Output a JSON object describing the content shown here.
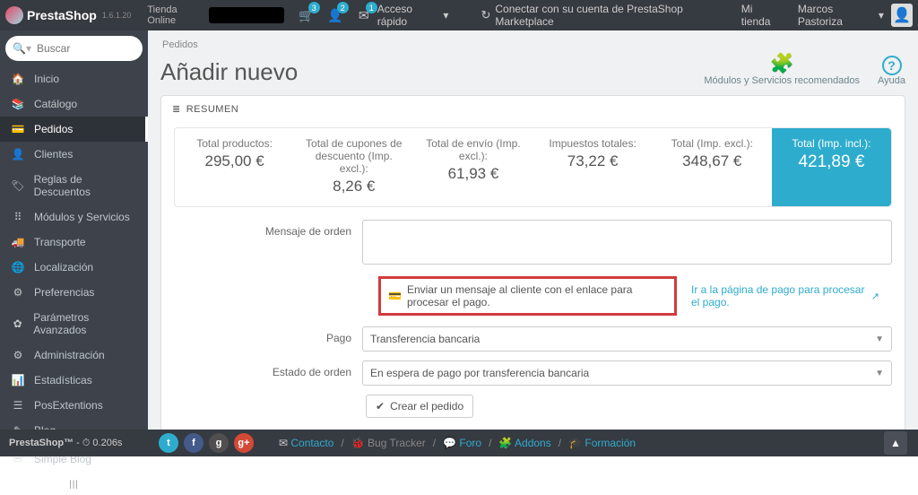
{
  "topbar": {
    "brand": "PrestaShop",
    "version": "1.6.1.20",
    "shop_name": "Tienda Online",
    "badges": {
      "cart": "3",
      "users": "2",
      "mail": "1"
    },
    "quick_access": "Acceso rápido",
    "marketplace": "Conectar con su cuenta de PrestaShop Marketplace",
    "my_shop": "Mi tienda",
    "user_name": "Marcos Pastoriza"
  },
  "search": {
    "placeholder": "Buscar",
    "dropdown": "▾"
  },
  "sidebar": {
    "items": [
      {
        "icon": "🏠",
        "label": "Inicio"
      },
      {
        "icon": "📚",
        "label": "Catálogo"
      },
      {
        "icon": "💳",
        "label": "Pedidos",
        "active": true
      },
      {
        "icon": "👤",
        "label": "Clientes"
      },
      {
        "icon": "🏷",
        "label": "Reglas de Descuentos"
      },
      {
        "icon": "⠿",
        "label": "Módulos y Servicios"
      },
      {
        "icon": "🚚",
        "label": "Transporte"
      },
      {
        "icon": "🌐",
        "label": "Localización"
      },
      {
        "icon": "⚙",
        "label": "Preferencias"
      },
      {
        "icon": "✿",
        "label": "Parámetros Avanzados"
      },
      {
        "icon": "⚙",
        "label": "Administración"
      },
      {
        "icon": "📊",
        "label": "Estadísticas"
      },
      {
        "icon": "☰",
        "label": "PosExtentions"
      },
      {
        "icon": "✎",
        "label": "Blog"
      },
      {
        "icon": "🗎",
        "label": "Simple Blog"
      }
    ],
    "collapse_icon": "|||"
  },
  "side_footer": {
    "tm": "PrestaShop™",
    "sep": " - ",
    "clock": "⏱",
    "time": "0.206s"
  },
  "main_footer": {
    "contact": "Contacto",
    "bug": "Bug Tracker",
    "forum": "Foro",
    "addons": "Addons",
    "training": "Formación"
  },
  "page": {
    "breadcrumb": "Pedidos",
    "title": "Añadir nuevo",
    "modules_label": "Módulos y Servicios recomendados",
    "help_label": "Ayuda"
  },
  "panel": {
    "heading": "RESUMEN"
  },
  "summary": {
    "products_label": "Total productos:",
    "products_value": "295,00 €",
    "coupons_label": "Total de cupones de descuento (Imp. excl.):",
    "coupons_value": "8,26 €",
    "shipping_label": "Total de envío (Imp. excl.):",
    "shipping_value": "61,93 €",
    "taxes_label": "Impuestos totales:",
    "taxes_value": "73,22 €",
    "total_excl_label": "Total (Imp. excl.):",
    "total_excl_value": "348,67 €",
    "total_incl_label": "Total (Imp. incl.):",
    "total_incl_value": "421,89 €"
  },
  "form": {
    "message_label": "Mensaje de orden",
    "send_link_text": "Enviar un mensaje al cliente con el enlace para procesar el pago.",
    "go_pay_text": "Ir a la página de pago para procesar el pago.",
    "payment_label": "Pago",
    "payment_value": "Transferencia bancaria",
    "status_label": "Estado de orden",
    "status_value": "En espera de pago por transferencia bancaria",
    "create_button": "Crear el pedido"
  }
}
